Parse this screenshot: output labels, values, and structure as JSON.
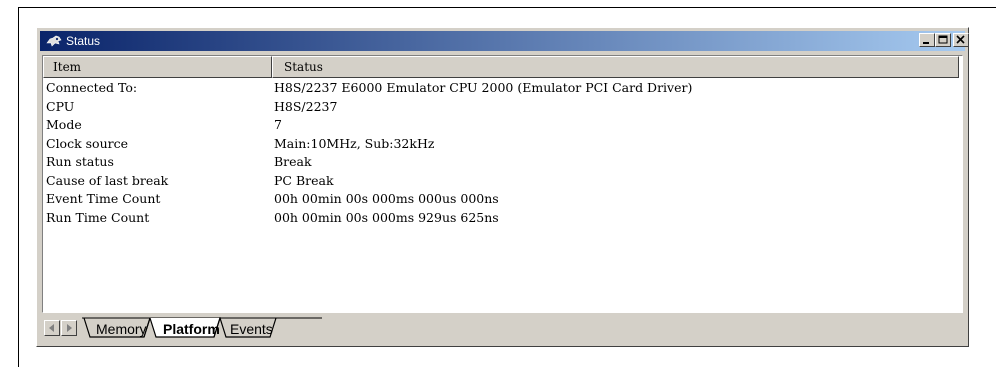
{
  "window": {
    "title": "Status"
  },
  "table": {
    "columns": [
      "Item",
      "Status"
    ],
    "rows": [
      {
        "item": "Connected To:",
        "status": "H8S/2237 E6000 Emulator CPU 2000 (Emulator PCI Card Driver)"
      },
      {
        "item": "CPU",
        "status": "H8S/2237"
      },
      {
        "item": "Mode",
        "status": "7"
      },
      {
        "item": "Clock source",
        "status": "Main:10MHz, Sub:32kHz"
      },
      {
        "item": "Run status",
        "status": "Break"
      },
      {
        "item": "Cause of last break",
        "status": "PC Break"
      },
      {
        "item": "Event Time Count",
        "status": "00h 00min 00s 000ms 000us 000ns"
      },
      {
        "item": "Run Time Count",
        "status": "00h 00min 00s 000ms 929us 625ns"
      }
    ]
  },
  "tabs": [
    {
      "label": "Memory",
      "active": false
    },
    {
      "label": "Platform",
      "active": true
    },
    {
      "label": "Events",
      "active": false
    }
  ],
  "colors": {
    "titlebar_start": "#0a246a",
    "titlebar_end": "#a6caf0",
    "face": "#d4d0c8"
  },
  "icons": {
    "window": "status-app-icon",
    "minimize": "minimize-icon",
    "maximize": "maximize-icon",
    "close": "close-icon",
    "scroll_left": "scroll-left-icon",
    "scroll_right": "scroll-right-icon"
  }
}
